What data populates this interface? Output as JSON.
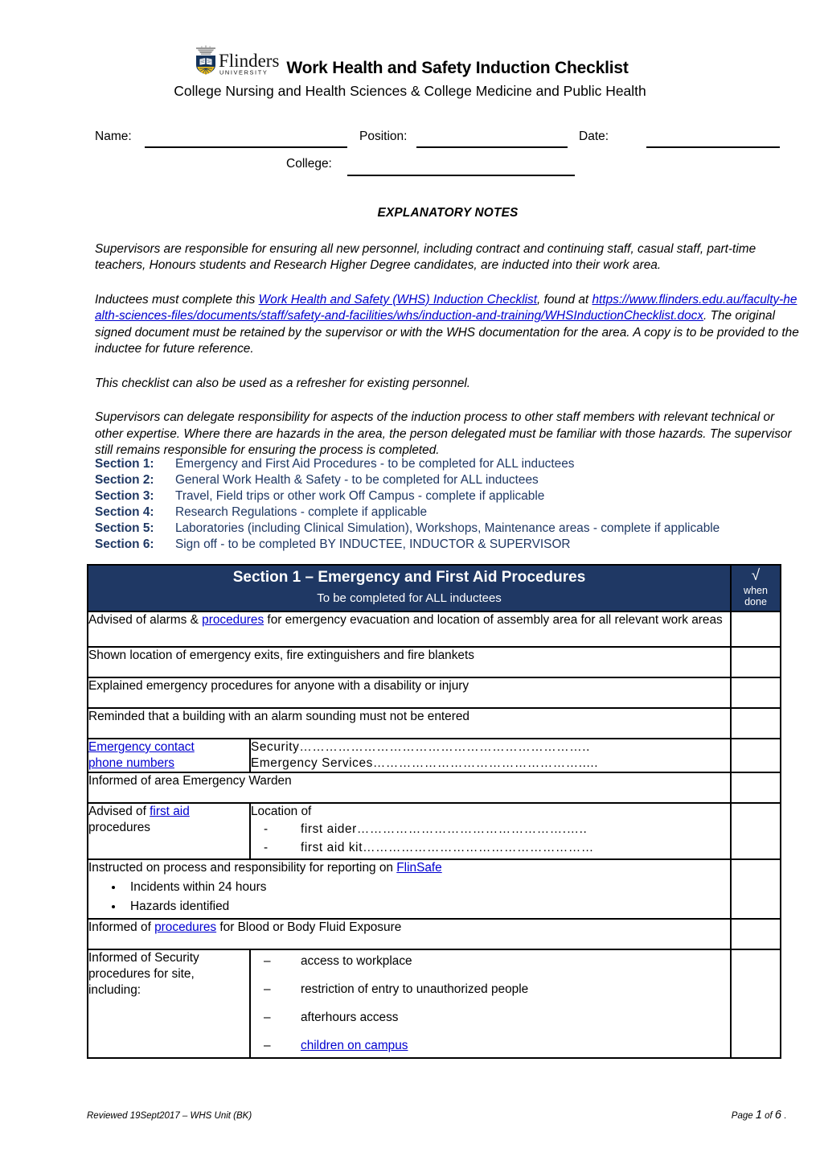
{
  "header": {
    "logo_name": "flinders-university-logo",
    "logo_wordmark": "Flinders",
    "logo_subword": "UNIVERSITY",
    "title": "Work Health and Safety Induction Checklist",
    "subtitle": "College Nursing and Health Sciences & College Medicine and Public Health"
  },
  "fields": {
    "name_label": "Name:",
    "name_value": "",
    "position_label": "Position:",
    "position_value": "",
    "date_label": "Date:",
    "date_value": "",
    "college_label": "College:",
    "college_value": ""
  },
  "notes": {
    "heading": "EXPLANATORY NOTES",
    "para1": "Supervisors are responsible for ensuring all new personnel, including contract and continuing staff, casual staff, part-time teachers, Honours students and Research Higher Degree candidates, are inducted into their work area.",
    "para2_pre": "Inductees must complete this ",
    "para2_link": "Work Health and Safety (WHS) Induction Checklist",
    "para2_mid": ", found at ",
    "para2_url": "https://www.flinders.edu.au/faculty-health-sciences-files/documents/staff/safety-and-facilities/whs/induction-and-training/WHSInductionChecklist.docx",
    "para2_post": ". The original signed document must be retained by the supervisor or with the WHS documentation for the area. A copy is to be provided to the inductee for future reference.",
    "para3": "This checklist can also be used as a refresher for existing personnel.",
    "para4": "Supervisors can delegate responsibility for aspects of the induction process to other staff members with relevant technical or other expertise. Where there are hazards in the area, the person delegated must be familiar with those hazards. The supervisor still remains responsible for ensuring the process is completed."
  },
  "section_list": {
    "color": "#1f3864",
    "items": [
      {
        "key": "Section 1:",
        "desc": "Emergency and First Aid Procedures - to be completed for ALL inductees"
      },
      {
        "key": "Section 2:",
        "desc": "General Work Health & Safety - to be completed for ALL inductees"
      },
      {
        "key": "Section 3:",
        "desc": "Travel, Field trips or other work Off Campus - complete if applicable"
      },
      {
        "key": "Section 4:",
        "desc": "Research Regulations - complete if applicable"
      },
      {
        "key": "Section 5:",
        "desc": "Laboratories (including Clinical Simulation), Workshops, Maintenance areas - complete if applicable"
      },
      {
        "key": "Section 6:",
        "desc": "Sign off - to be completed BY INDUCTEE, INDUCTOR & SUPERVISOR"
      }
    ]
  },
  "table": {
    "header_bg": "#1f3864",
    "header_title": "Section 1 – Emergency and First Aid Procedures",
    "header_subtitle": "To be completed for ALL inductees",
    "check_col_tick": "√",
    "check_col_line1": "when",
    "check_col_line2": "done",
    "rows": {
      "r1_pre": "Advised of alarms & ",
      "r1_link": "procedures",
      "r1_post": " for emergency evacuation and location of assembly area for all relevant work areas",
      "r2": "Shown location of emergency exits, fire extinguishers and fire blankets",
      "r3": "Explained emergency procedures for anyone with a disability or injury",
      "r4": "Reminded that a building with an alarm sounding must not be entered",
      "r5_link_line1": "Emergency contact ",
      "r5_link_line2": "phone numbers",
      "r5_right_line1": "Security…………………………………………………………..",
      "r5_right_line2": "Emergency Services………………………………………….....",
      "r6": "Informed of area Emergency Warden",
      "r7_left_pre": "Advised of ",
      "r7_left_link": "first aid",
      "r7_left_post": " procedures",
      "r7_right_title": "Location of",
      "r7_right_items": [
        "first aider………………………………………….…..",
        "first aid kit………………………………………………"
      ],
      "r8_pre": "Instructed on process and responsibility for reporting on ",
      "r8_link": "FlinSafe",
      "r8_bullets": [
        "Incidents within 24 hours",
        "Hazards identified"
      ],
      "r9_pre": "Informed of ",
      "r9_link": "procedures",
      "r9_post": " for Blood or Body Fluid Exposure",
      "r10_left": "Informed of Security procedures for site, including:",
      "r10_items": [
        {
          "text": "access to workplace",
          "link": false
        },
        {
          "text": "restriction of entry to unauthorized people",
          "link": false
        },
        {
          "text": "afterhours access",
          "link": false
        },
        {
          "text": "children on campus",
          "link": true
        }
      ],
      "dash_glyph": "–",
      "hyphen_glyph": "-"
    }
  },
  "footer": {
    "left": "Reviewed 19Sept2017 – WHS Unit (BK)",
    "page_word": "Page",
    "page_number": "1",
    "of_word": "of",
    "page_total": "6",
    "trailing_dot": "."
  }
}
